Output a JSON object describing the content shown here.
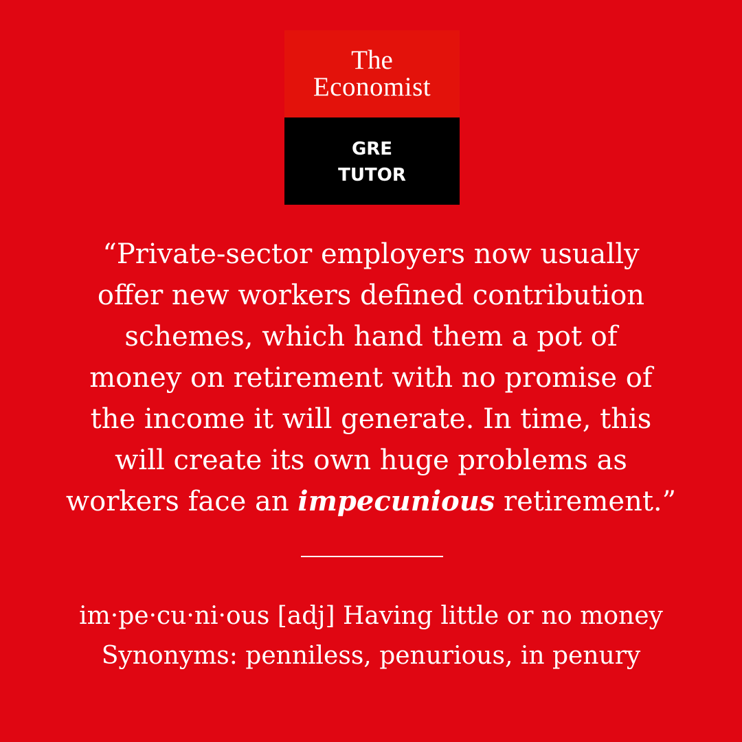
{
  "logo": {
    "title_line1": "The",
    "title_line2": "Economist",
    "sub_line1": "GRE",
    "sub_line2": "TUTOR"
  },
  "quote": {
    "lines": [
      "“Private-sector employers now usually",
      "offer new workers defined contribution",
      "schemes, which hand them a pot of",
      "money on retirement with no promise of",
      "the income it will generate. In time, this",
      "will create its own huge problems as"
    ],
    "last_line_before": "workers face an ",
    "keyword": "impecunious",
    "last_line_after": " retirement.”"
  },
  "definition": {
    "line1": "im·pe·cu·ni·ous [adj] Having little or no money",
    "line2": "Synonyms: penniless, penurious, in penury"
  },
  "colors": {
    "background": "#e00612",
    "logo_red": "#e3120b",
    "logo_black": "#000000",
    "text": "#ffffff"
  }
}
